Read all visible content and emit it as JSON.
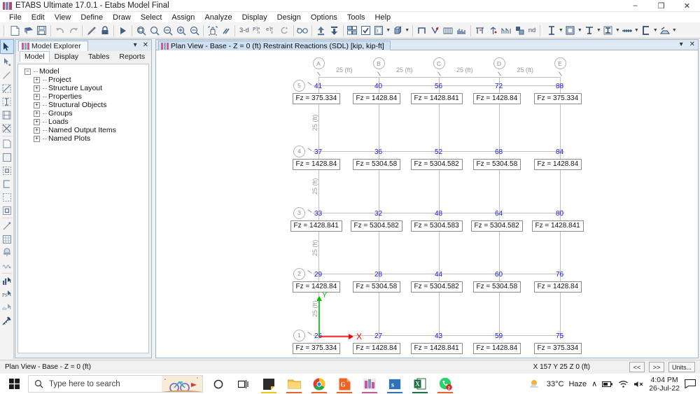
{
  "window": {
    "title": "ETABS Ultimate 17.0.1 - Etabs Model Final",
    "app_icon": "etabs-building-icon",
    "minimize": "–",
    "maximize": "❐",
    "close": "✕"
  },
  "menubar": {
    "items": [
      "File",
      "Edit",
      "View",
      "Define",
      "Draw",
      "Select",
      "Assign",
      "Analyze",
      "Display",
      "Design",
      "Options",
      "Tools",
      "Help"
    ]
  },
  "toolbar": {
    "labels": {
      "three_d": "3-d",
      "plan": "Pl",
      "elev": "el",
      "nd": "nd"
    }
  },
  "explorer": {
    "tab_title": "Model Explorer",
    "dropdown_icon": "▾",
    "close_icon": "✕",
    "subtabs": [
      "Model",
      "Display",
      "Tables",
      "Reports"
    ],
    "active_subtab": "Model",
    "tree": {
      "root": "Model",
      "children": [
        "Project",
        "Structure Layout",
        "Properties",
        "Structural Objects",
        "Groups",
        "Loads",
        "Named Output Items",
        "Named Plots"
      ]
    }
  },
  "view": {
    "tab_label": "Plan View - Base - Z = 0 (ft)    Restraint Reactions    (SDL)  [kip, kip-ft]",
    "dropdown_icon": "▾",
    "close_icon": "✕",
    "axes": {
      "x_label": "X",
      "y_label": "Y"
    }
  },
  "plan": {
    "column_bubbles": [
      "A",
      "B",
      "C",
      "D",
      "E"
    ],
    "row_bubbles": [
      "5",
      "4",
      "3",
      "2",
      "1"
    ],
    "column_dims": [
      "25 (ft)",
      "25 (ft)",
      "25 (ft)",
      "25 (ft)"
    ],
    "row_dims": [
      "25 (ft)",
      "25 (ft)",
      "25 (ft)",
      "25 (ft)"
    ],
    "rows": [
      {
        "row": "5",
        "nodes": [
          "41",
          "40",
          "56",
          "72",
          "88"
        ],
        "reactions": [
          "Fz = 375.334",
          "Fz = 1428.84",
          "Fz = 1428.841",
          "Fz = 1428.84",
          "Fz = 375.334"
        ]
      },
      {
        "row": "4",
        "nodes": [
          "37",
          "36",
          "52",
          "68",
          "84"
        ],
        "reactions": [
          "Fz = 1428.84",
          "Fz = 5304.58",
          "Fz = 5304.582",
          "Fz = 5304.58",
          "Fz = 1428.84"
        ]
      },
      {
        "row": "3",
        "nodes": [
          "33",
          "32",
          "48",
          "64",
          "80"
        ],
        "reactions": [
          "Fz = 1428.841",
          "Fz = 5304.582",
          "Fz = 5304.583",
          "Fz = 5304.582",
          "Fz = 1428.841"
        ]
      },
      {
        "row": "2",
        "nodes": [
          "29",
          "28",
          "44",
          "60",
          "76"
        ],
        "reactions": [
          "Fz = 1428.84",
          "Fz = 5304.58",
          "Fz = 5304.582",
          "Fz = 5304.58",
          "Fz = 1428.84"
        ]
      },
      {
        "row": "1",
        "nodes": [
          "26",
          "27",
          "43",
          "59",
          "75"
        ],
        "reactions": [
          "Fz = 375.334",
          "Fz = 1428.84",
          "Fz = 1428.841",
          "Fz = 1428.84",
          "Fz = 375.334"
        ]
      }
    ]
  },
  "statusbar": {
    "left_text": "Plan View - Base - Z = 0 (ft)",
    "coordinates": "X 157  Y 25  Z 0 (ft)",
    "prev_button": "<<",
    "next_button": ">>",
    "units_button": "Units..."
  },
  "taskbar": {
    "search_placeholder": "Type here to search",
    "weather_temp": "33°C",
    "weather_cond": "Haze",
    "time": "4:04 PM",
    "date": "26-Jul-22",
    "whatsapp_badge": "2",
    "chevron_icon": "∧"
  },
  "colors": {
    "node_blue": "#1414ff",
    "axis_x_red": "#ff0000",
    "axis_y_green": "#00c000",
    "grid_gray": "#bfbfbf",
    "panel_border": "#9fb6cd"
  }
}
